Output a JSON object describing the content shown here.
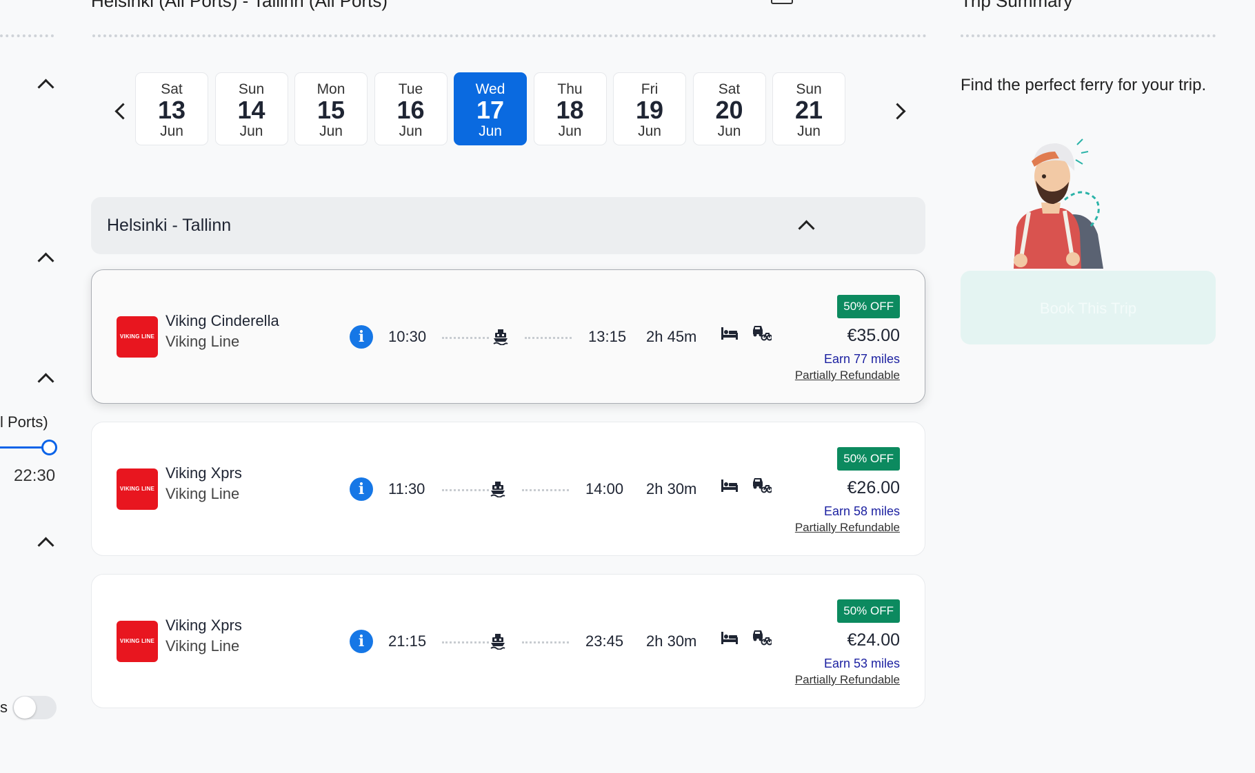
{
  "header": {
    "route_title": "Helsinki (All Ports) - Tallinn (All Ports)",
    "summary_title": "Trip Summary"
  },
  "filters": {
    "ports_label": "l Ports)",
    "slider_end_time": "22:30",
    "toggle_label_fragment": "s"
  },
  "dates": [
    {
      "dow": "Sat",
      "day": "13",
      "mon": "Jun"
    },
    {
      "dow": "Sun",
      "day": "14",
      "mon": "Jun"
    },
    {
      "dow": "Mon",
      "day": "15",
      "mon": "Jun"
    },
    {
      "dow": "Tue",
      "day": "16",
      "mon": "Jun"
    },
    {
      "dow": "Wed",
      "day": "17",
      "mon": "Jun",
      "selected": true
    },
    {
      "dow": "Thu",
      "day": "18",
      "mon": "Jun"
    },
    {
      "dow": "Fri",
      "day": "19",
      "mon": "Jun"
    },
    {
      "dow": "Sat",
      "day": "20",
      "mon": "Jun"
    },
    {
      "dow": "Sun",
      "day": "21",
      "mon": "Jun"
    }
  ],
  "route": {
    "title": "Helsinki - Tallinn"
  },
  "sailings": [
    {
      "logo_text": "VIKING LINE",
      "ship": "Viking Cinderella",
      "operator": "Viking Line",
      "depart": "10:30",
      "arrive": "13:15",
      "duration": "2h 45m",
      "discount": "50% OFF",
      "price": "€35.00",
      "miles": "Earn 77 miles",
      "refund": "Partially Refundable"
    },
    {
      "logo_text": "VIKING LINE",
      "ship": "Viking Xprs",
      "operator": "Viking Line",
      "depart": "11:30",
      "arrive": "14:00",
      "duration": "2h 30m",
      "discount": "50% OFF",
      "price": "€26.00",
      "miles": "Earn 58 miles",
      "refund": "Partially Refundable"
    },
    {
      "logo_text": "VIKING LINE",
      "ship": "Viking Xprs",
      "operator": "Viking Line",
      "depart": "21:15",
      "arrive": "23:45",
      "duration": "2h 30m",
      "discount": "50% OFF",
      "price": "€24.00",
      "miles": "Earn 53 miles",
      "refund": "Partially Refundable"
    }
  ],
  "summary": {
    "text": "Find the perfect ferry for your trip.",
    "book_button": "Book This Trip"
  },
  "colors": {
    "accent_blue": "#0a6ae0",
    "discount_green": "#0c8a5f",
    "miles_blue": "#1a1fa0",
    "logo_red": "#e8161f",
    "book_button_bg": "#e4f4f2"
  }
}
